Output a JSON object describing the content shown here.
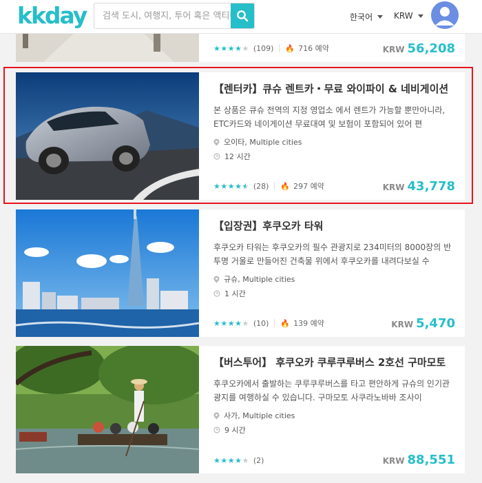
{
  "brand": {
    "logo_text": "kkday",
    "accent": "#26bec9"
  },
  "search": {
    "placeholder": "검색 도시, 여행지, 투어 혹은 액티비티",
    "icon": "search-icon"
  },
  "header": {
    "language": "한국어",
    "currency": "KRW"
  },
  "products": [
    {
      "rating_count": "(109)",
      "bookings": "716 예약",
      "currency": "KRW",
      "price": "56,208",
      "stars": 4
    },
    {
      "title": "【렌터카】큐슈 렌트카・무료 와이파이 & 네비게이션",
      "description": "본 상품은 큐슈 전역의 지정 영업소 에서 렌트가 가능할 뿐만아니라, ETC카드와 네이게이션 무료대여 및 보험이 포함되어 있어 편",
      "location": "오이타, Multiple cities",
      "duration": "12 시간",
      "rating_count": "(28)",
      "bookings": "297 예약",
      "currency": "KRW",
      "price": "43,778",
      "stars": 4.5
    },
    {
      "title": "【입장권】후쿠오카 타워",
      "description": "후쿠오카 타워는 후쿠오카의 필수 관광지로 234미터의 8000장의 반투명 거울로 만들어진 건축물 위에서 후쿠오카를 내려다보실 수",
      "location": "규슈, Multiple cities",
      "duration": "1 시간",
      "rating_count": "(10)",
      "bookings": "139 예약",
      "currency": "KRW",
      "price": "5,470",
      "stars": 4
    },
    {
      "title": "【버스투어】 후쿠오카 쿠루쿠루버스 2호선 구마모토",
      "description": "후쿠오카에서 출발하는 쿠루쿠루버스를 타고 편안하게 규슈의 인기관광지를 여행하실 수 있습니다. 구마모토 사쿠라노바바 조사이",
      "location": "사가, Multiple cities",
      "duration": "9 시간",
      "rating_count": "(2)",
      "currency": "KRW",
      "price": "88,551",
      "stars": 4
    }
  ]
}
